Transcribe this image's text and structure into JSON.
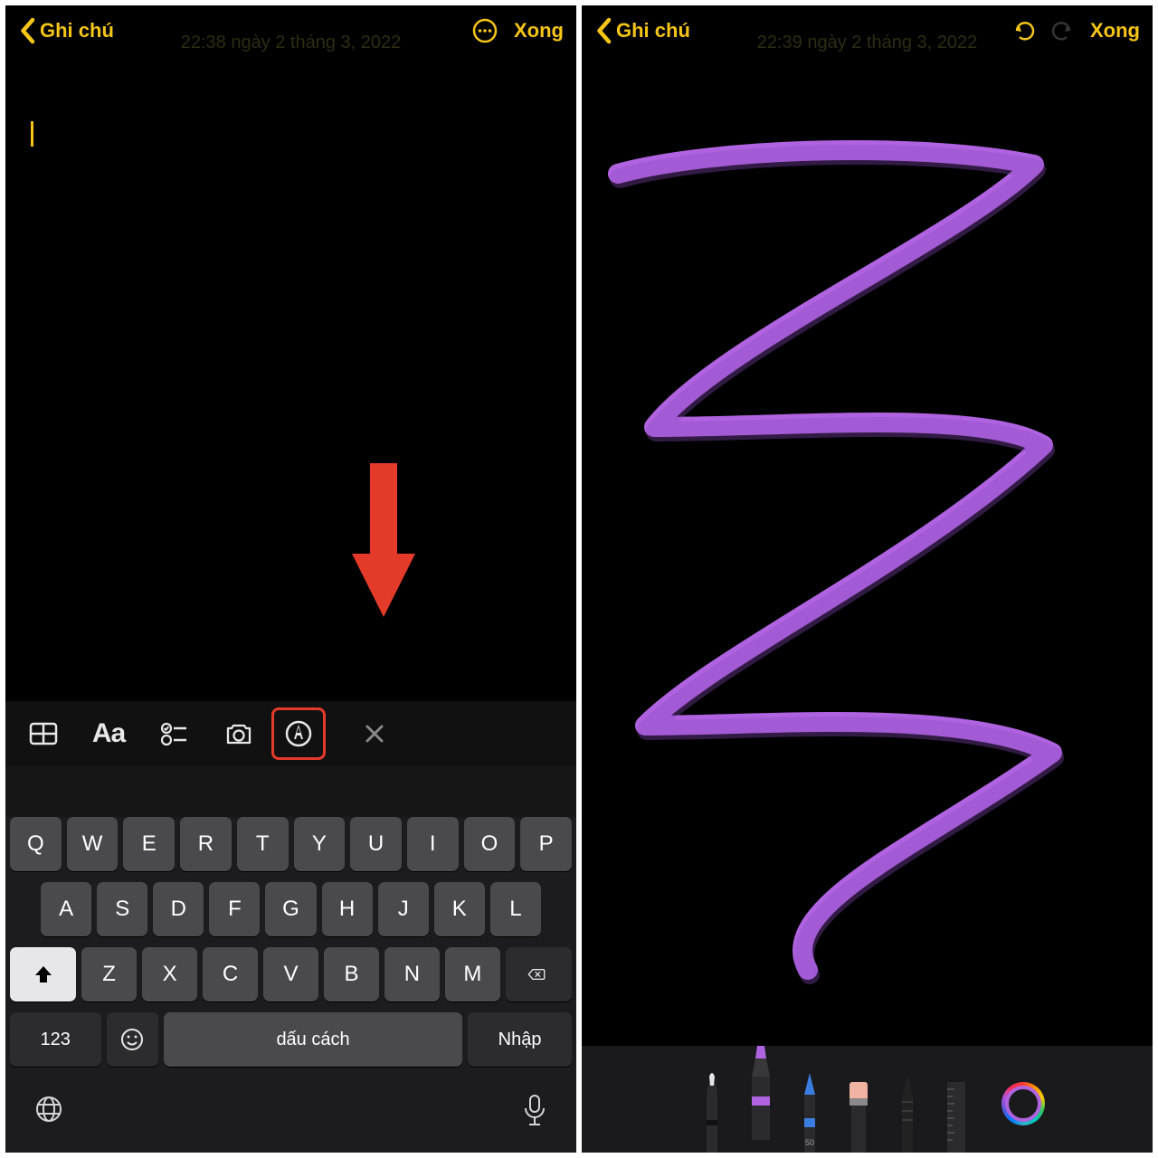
{
  "colors": {
    "accent": "#f5c518",
    "highlight": "#e43a2a",
    "stroke": "#b063e0"
  },
  "left": {
    "back_label": "Ghi chú",
    "done_label": "Xong",
    "timestamp_faint": "22:38 ngày 2 tháng 3, 2022",
    "format_icons": [
      "table",
      "text-format",
      "checklist",
      "camera",
      "markup",
      "close"
    ],
    "keyboard": {
      "row1": [
        "Q",
        "W",
        "E",
        "R",
        "T",
        "Y",
        "U",
        "I",
        "O",
        "P"
      ],
      "row2": [
        "A",
        "S",
        "D",
        "F",
        "G",
        "H",
        "J",
        "K",
        "L"
      ],
      "row3": [
        "Z",
        "X",
        "C",
        "V",
        "B",
        "N",
        "M"
      ],
      "numbers_label": "123",
      "space_label": "dấu cách",
      "enter_label": "Nhập"
    }
  },
  "right": {
    "back_label": "Ghi chú",
    "done_label": "Xong",
    "timestamp_faint": "22:39 ngày 2 tháng 3, 2022",
    "tools": [
      "pen",
      "marker",
      "pencil",
      "eraser",
      "lasso",
      "ruler"
    ],
    "pencil_size_label": "50"
  }
}
